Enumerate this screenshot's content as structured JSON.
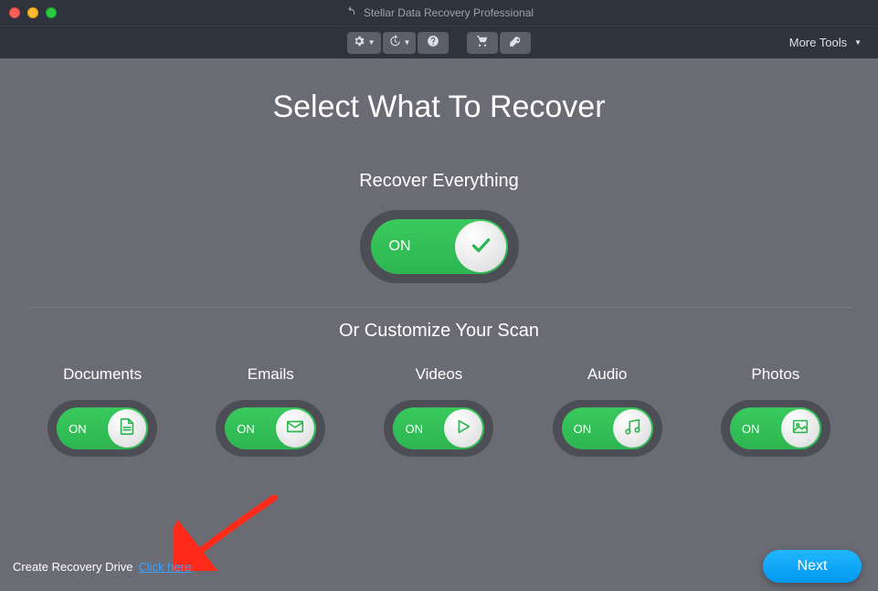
{
  "app": {
    "title": "Stellar Data Recovery Professional"
  },
  "toolbar": {
    "more_tools": "More Tools"
  },
  "main": {
    "title": "Select What To Recover",
    "recover_everything_label": "Recover Everything",
    "big_toggle": {
      "state": "ON"
    },
    "customize_label": "Or Customize Your Scan",
    "categories": [
      {
        "label": "Documents",
        "state": "ON",
        "icon": "document-icon"
      },
      {
        "label": "Emails",
        "state": "ON",
        "icon": "email-icon"
      },
      {
        "label": "Videos",
        "state": "ON",
        "icon": "play-icon"
      },
      {
        "label": "Audio",
        "state": "ON",
        "icon": "music-icon"
      },
      {
        "label": "Photos",
        "state": "ON",
        "icon": "image-icon"
      }
    ]
  },
  "footer": {
    "recovery_drive_label": "Create Recovery Drive",
    "click_here": "Click here",
    "next": "Next"
  }
}
